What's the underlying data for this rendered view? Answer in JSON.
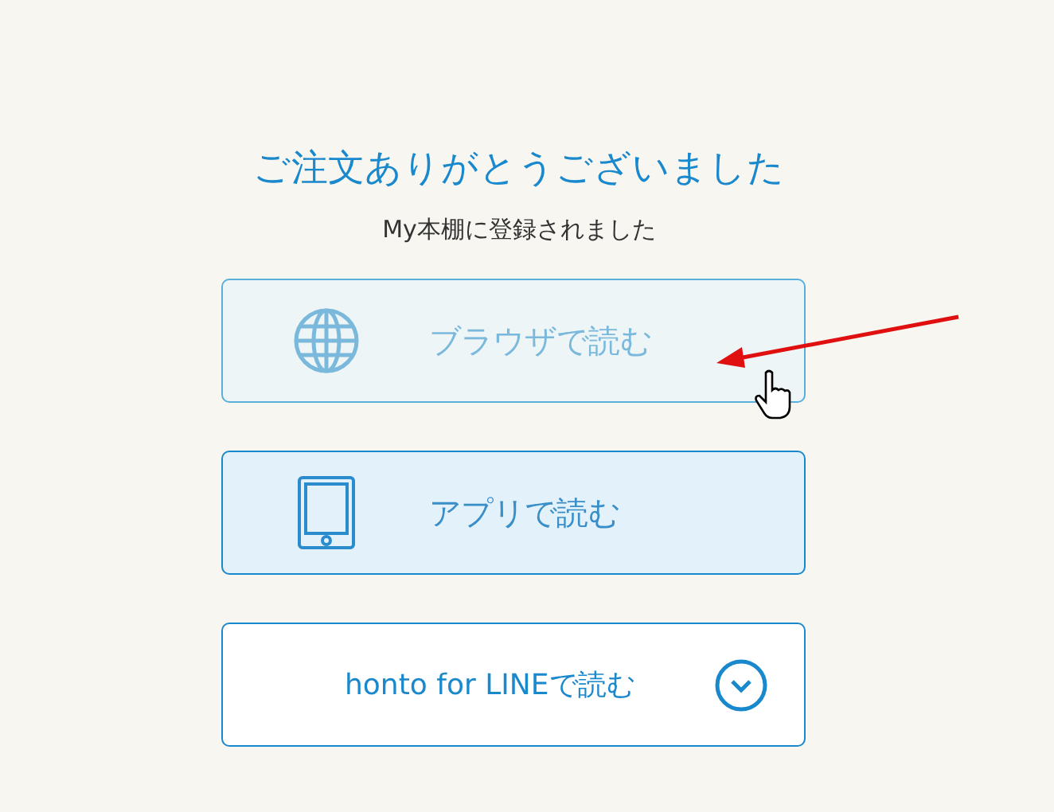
{
  "title": "ご注文ありがとうございました",
  "subtitle": "My本棚に登録されました",
  "buttons": [
    {
      "kind": "browser",
      "label": "ブラウザで読む",
      "hovered": true
    },
    {
      "kind": "app",
      "label": "アプリで読む",
      "hovered": false
    },
    {
      "kind": "line",
      "label": "honto for LINEで読む",
      "hovered": false
    }
  ]
}
